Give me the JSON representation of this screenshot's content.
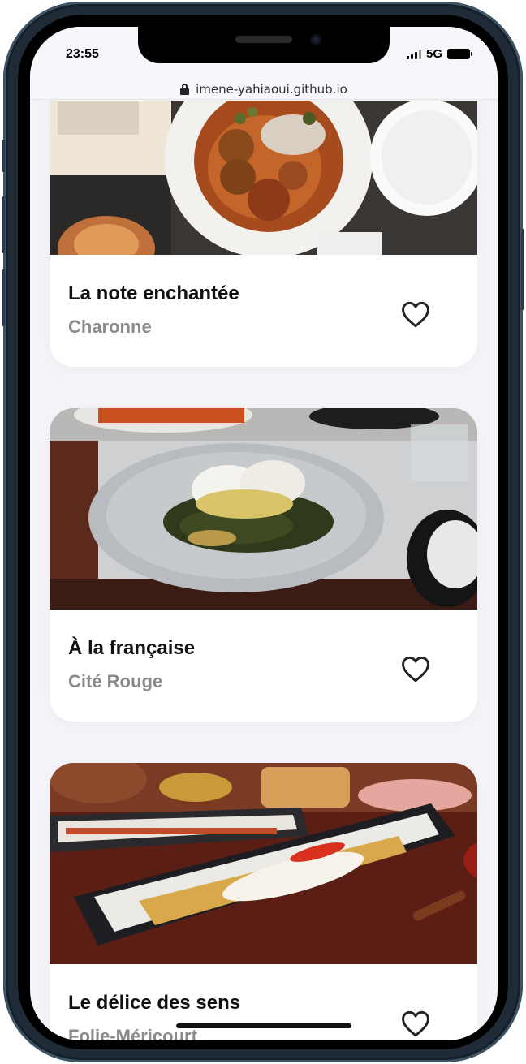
{
  "status": {
    "time": "23:55",
    "network": "5G"
  },
  "browser": {
    "url": "imene-yahiaoui.github.io"
  },
  "restaurants": [
    {
      "name": "La note enchantée",
      "area": "Charonne"
    },
    {
      "name": "À la française",
      "area": "Cité Rouge"
    },
    {
      "name": "Le délice des sens",
      "area": "Folie-Méricourt"
    }
  ],
  "icons": {
    "favorite": "heart-outline-icon",
    "secure": "lock-icon"
  },
  "colors": {
    "screen_background": "#f5f4f8",
    "card_background": "#ffffff",
    "title_text": "#111111",
    "subtitle_text": "#8a8a8a",
    "accent_mint": "#a8e6cf"
  }
}
